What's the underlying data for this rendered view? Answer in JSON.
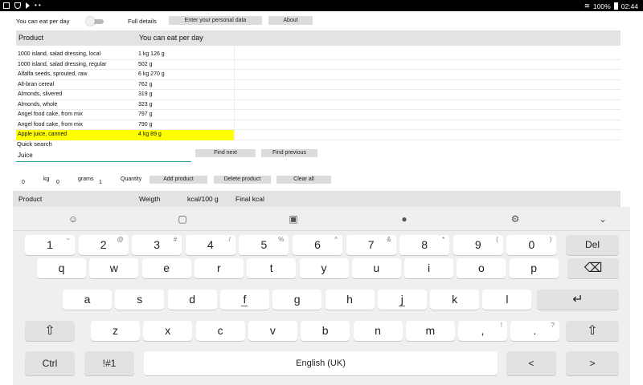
{
  "status_bar": {
    "battery": "100%",
    "time": "02:44"
  },
  "top_controls": {
    "you_can_eat_label": "You can eat per day",
    "full_details_label": "Full details",
    "personal_data_button": "Enter your personal data",
    "about_button": "About"
  },
  "table": {
    "columns": [
      "Product",
      "You can eat per day"
    ],
    "rows": [
      {
        "product": "1000 island, salad dressing, local",
        "amount": "1 kg 126 g"
      },
      {
        "product": "1000 island, salad dressing, regular",
        "amount": "502 g"
      },
      {
        "product": "Alfalfa seeds, sprouted, raw",
        "amount": "6 kg 270 g"
      },
      {
        "product": "All-bran cereal",
        "amount": "762 g"
      },
      {
        "product": "Almonds, slivered",
        "amount": "319 g"
      },
      {
        "product": "Almonds, whole",
        "amount": "323 g"
      },
      {
        "product": "Angel food cake, from mix",
        "amount": "797 g"
      },
      {
        "product": "Angel food cake, from mix",
        "amount": "790 g"
      },
      {
        "product": "Apple juice, canned",
        "amount": "4 kg 89 g",
        "highlighted": true
      }
    ],
    "highlight_color": "#ffff00"
  },
  "search": {
    "label": "Quick search",
    "value": "Juice",
    "find_next_button": "Find next",
    "find_previous_button": "Find previous"
  },
  "quantity": {
    "kg_value": "0",
    "kg_label": "kg",
    "grams_value": "0",
    "grams_label": "grams",
    "extra_value": "1",
    "quantity_label": "Quantity",
    "add_button": "Add product",
    "delete_button": "Delete product",
    "clear_button": "Clear all"
  },
  "selected_table": {
    "columns": [
      "Product",
      "Weigth",
      "kcal/100 g",
      "Final kcal"
    ]
  },
  "keyboard": {
    "toolbar_icons": [
      "emoji-icon",
      "sticker-icon",
      "gif-icon",
      "microphone-icon",
      "settings-icon",
      "chevron-down-icon"
    ],
    "toolbar_glyphs": [
      "☺",
      "▢",
      "▣",
      "●",
      "⚙",
      "⌄"
    ],
    "number_row": [
      {
        "main": "1",
        "hint": "~"
      },
      {
        "main": "2",
        "hint": "@"
      },
      {
        "main": "3",
        "hint": "#"
      },
      {
        "main": "4",
        "hint": "/"
      },
      {
        "main": "5",
        "hint": "%"
      },
      {
        "main": "6",
        "hint": "^"
      },
      {
        "main": "7",
        "hint": "&"
      },
      {
        "main": "8",
        "hint": "*"
      },
      {
        "main": "9",
        "hint": "("
      },
      {
        "main": "0",
        "hint": ")"
      }
    ],
    "del_label": "Del",
    "row_q": [
      "q",
      "w",
      "e",
      "r",
      "t",
      "y",
      "u",
      "i",
      "o",
      "p"
    ],
    "row_a": [
      "a",
      "s",
      "d",
      "f",
      "g",
      "h",
      "j",
      "k",
      "l"
    ],
    "row_z": [
      "z",
      "x",
      "c",
      "v",
      "b",
      "n",
      "m"
    ],
    "comma_key": {
      "main": ",",
      "hint": "!"
    },
    "period_key": {
      "main": ".",
      "hint": "?"
    },
    "backspace_glyph": "⌫",
    "enter_glyph": "↵",
    "shift_glyph": "⇧",
    "ctrl_label": "Ctrl",
    "symbols_label": "!#1",
    "space_label": "English (UK)",
    "left_arrow_glyph": "<",
    "right_arrow_glyph": ">"
  }
}
